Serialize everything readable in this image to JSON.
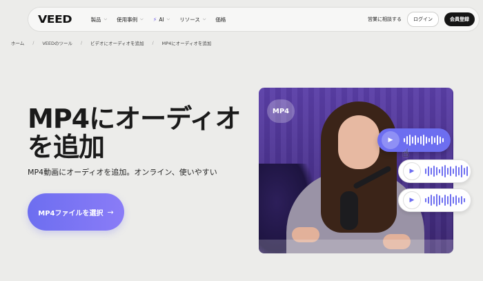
{
  "nav": {
    "logo": "VEED",
    "items": [
      {
        "label": "製品",
        "has_menu": true
      },
      {
        "label": "使用事例",
        "has_menu": true
      },
      {
        "label": "AI",
        "has_menu": true,
        "icon": "bolt-icon"
      },
      {
        "label": "リソース",
        "has_menu": true
      },
      {
        "label": "価格",
        "has_menu": false
      }
    ],
    "contact_sales": "営業に相談する",
    "login": "ログイン",
    "signup": "会員登録"
  },
  "breadcrumb": [
    "ホーム",
    "VEEDのツール",
    "ビデオにオーディオを追加",
    "MP4にオーディオを追加"
  ],
  "hero": {
    "title": "MP4にオーディオを追加",
    "subtitle": "MP4動画にオーディオを追加。オンライン、使いやすい",
    "cta_label": "MP4ファイルを選択",
    "cta_arrow": "→"
  },
  "media": {
    "badge": "MP4",
    "audio_tracks": [
      {
        "state": "active",
        "play_icon": "▶"
      },
      {
        "state": "idle",
        "play_icon": "▶"
      },
      {
        "state": "idle",
        "play_icon": "▶"
      }
    ]
  },
  "colors": {
    "accent": "#6d6ef0",
    "background": "#ececea",
    "dark_button": "#151515"
  }
}
